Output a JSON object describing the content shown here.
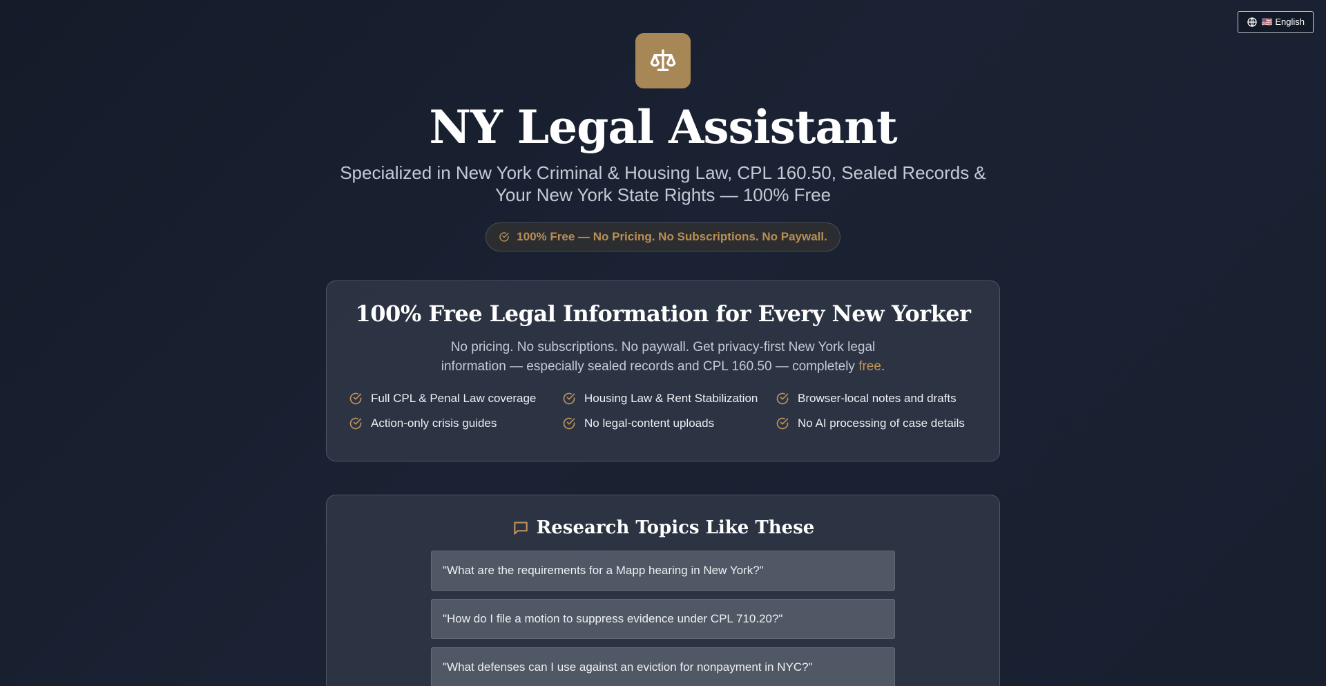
{
  "language": {
    "label": "🇺🇸 English"
  },
  "header": {
    "title": "NY Legal Assistant",
    "subtitle": "Specialized in New York Criminal & Housing Law, CPL 160.50, Sealed Records & Your New York State Rights — 100% Free",
    "free_badge": "100% Free — No Pricing. No Subscriptions. No Paywall."
  },
  "free_card": {
    "heading": "100% Free Legal Information for Every New Yorker",
    "desc_pre": "No pricing. No subscriptions. No paywall. Get privacy-first New York legal information — especially sealed records and CPL 160.50 — completely ",
    "desc_highlight": "free",
    "desc_post": ".",
    "features": [
      "Full CPL & Penal Law coverage",
      "Housing Law & Rent Stabilization",
      "Browser-local notes and drafts",
      "Action-only crisis guides",
      "No legal-content uploads",
      "No AI processing of case details"
    ]
  },
  "topics_card": {
    "heading": "Research Topics Like These",
    "topics": [
      "\"What are the requirements for a Mapp hearing in New York?\"",
      "\"How do I file a motion to suppress evidence under CPL 710.20?\"",
      "\"What defenses can I use against an eviction for nonpayment in NYC?\""
    ]
  },
  "colors": {
    "accent": "#a88757",
    "accent_text": "#c0935a",
    "background": "#161d2b"
  },
  "icons": {
    "language": "globe-icon",
    "logo": "scales-icon",
    "check": "check-circle-icon",
    "topics": "chat-bubble-icon"
  }
}
